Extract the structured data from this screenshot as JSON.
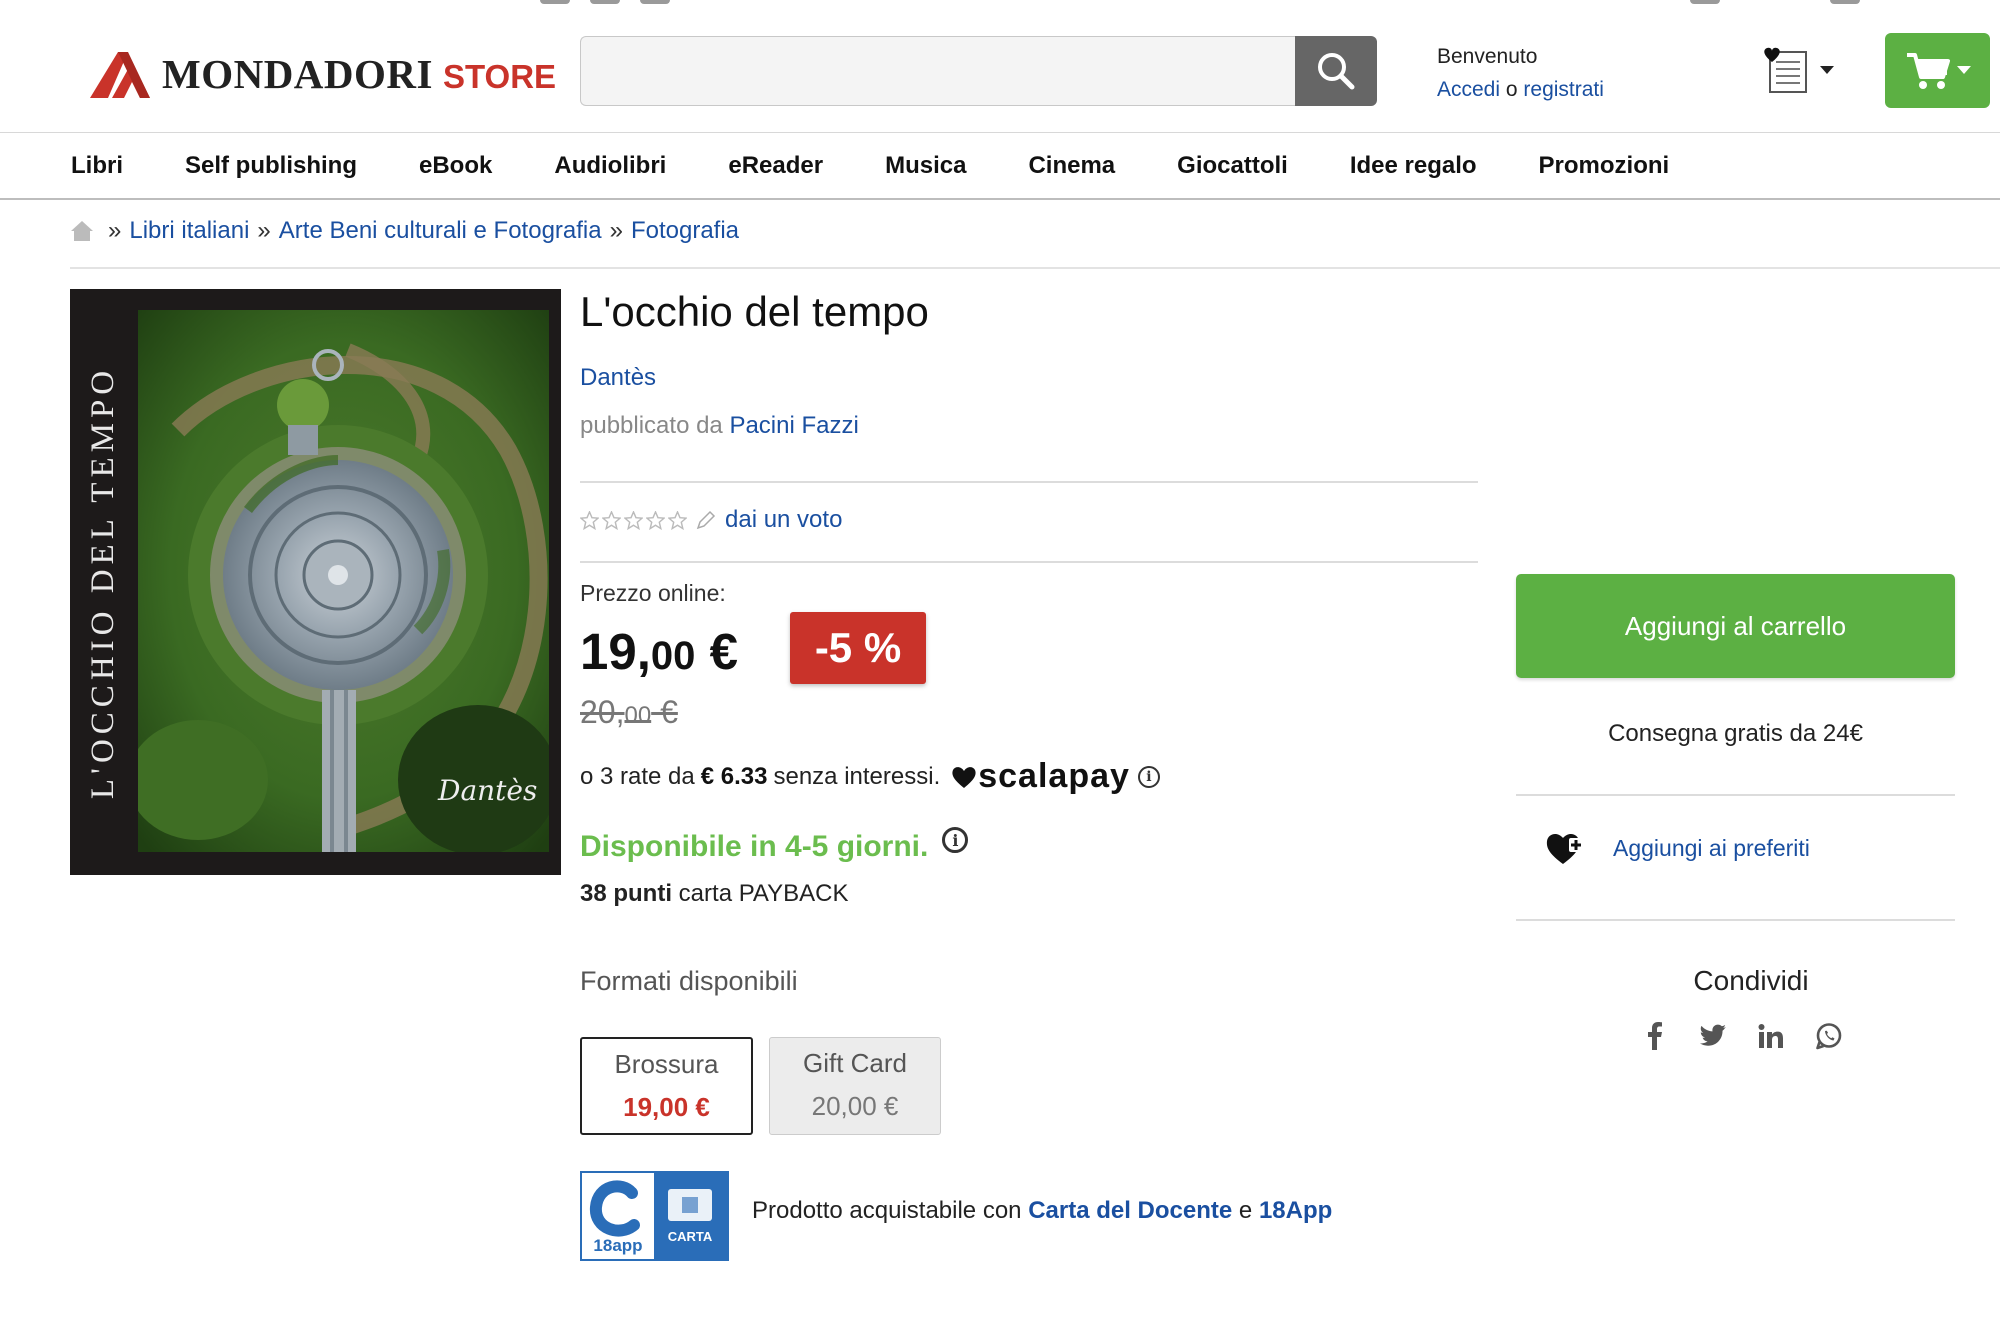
{
  "header": {
    "logo_main": "MONDADORI",
    "logo_store": "STORE",
    "search_placeholder": "",
    "welcome": "Benvenuto",
    "login_link": "Accedi",
    "or": " o ",
    "register_link": "registrati"
  },
  "nav": [
    "Libri",
    "Self publishing",
    "eBook",
    "Audiolibri",
    "eReader",
    "Musica",
    "Cinema",
    "Giocattoli",
    "Idee regalo",
    "Promozioni"
  ],
  "breadcrumb": [
    "Libri italiani",
    "Arte Beni culturali e Fotografia",
    "Fotografia"
  ],
  "breadcrumb_sep": "»",
  "cover": {
    "spine_text": "L'OCCHIO DEL TEMPO",
    "signature": "Dantès"
  },
  "product": {
    "title": "L'occhio del tempo",
    "author": "Dantès",
    "publisher_prefix": "pubblicato da",
    "publisher": "Pacini Fazzi",
    "rating_link": "dai un voto",
    "rating_value": 0,
    "rating_max": 5,
    "price_label": "Prezzo online:",
    "price_int": "19,",
    "price_dec": "00",
    "price_cur": " €",
    "discount": "-5 %",
    "old_price_int": "20,",
    "old_price_dec": "00",
    "old_price_cur": " €",
    "installments_pre": "o 3 rate da",
    "installments_amount": "€ 6.33",
    "installments_post": "senza interessi.",
    "scalapay": "scalapay",
    "availability": "Disponibile in 4-5 giorni.",
    "points_bold": "38 punti",
    "points_rest": " carta PAYBACK",
    "formats_label": "Formati disponibili",
    "formats": [
      {
        "name": "Brossura",
        "price": "19,00 €"
      },
      {
        "name": "Gift Card",
        "price": "20,00 €"
      }
    ],
    "badge_18": "18app",
    "badge_doc": "CARTA",
    "teacher_pre": "Prodotto acquistabile con ",
    "teacher_card": "Carta del Docente",
    "teacher_and": " e ",
    "teacher_app": "18App"
  },
  "side": {
    "add_to_cart": "Aggiungi al carrello",
    "free_shipping": "Consegna gratis da 24€",
    "add_favorites": "Aggiungi ai preferiti",
    "share": "Condividi",
    "share_icons": [
      "facebook-icon",
      "twitter-icon",
      "linkedin-icon",
      "whatsapp-icon"
    ]
  },
  "colors": {
    "accent_green": "#5cb043",
    "availability_green": "#6bbd4e",
    "brand_red": "#c9332a",
    "link_blue": "#1a4fa0"
  }
}
